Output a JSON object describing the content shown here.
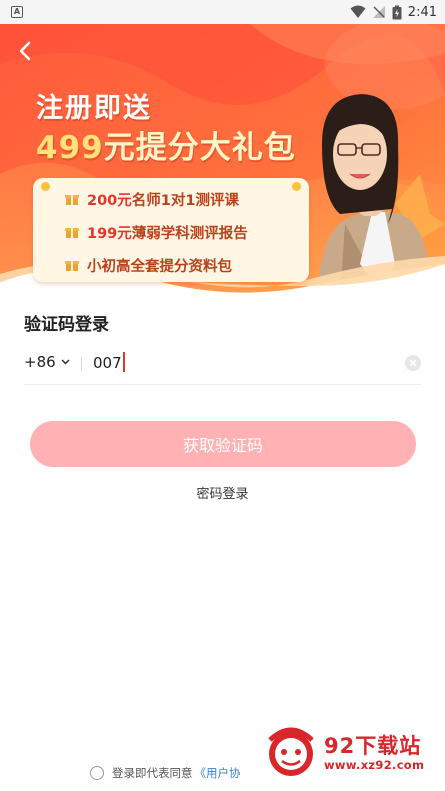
{
  "status_bar": {
    "time": "2:41"
  },
  "hero": {
    "title_line1": "注册即送",
    "title_line2_num": "499",
    "title_line2_text": "元提分大礼包",
    "benefits": [
      {
        "num": "200元",
        "text": "名师1对1测评课"
      },
      {
        "num": "199元",
        "text": "薄弱学科测评报告"
      },
      {
        "num": "",
        "text": "小初高全套提分资料包"
      }
    ]
  },
  "login": {
    "title": "验证码登录",
    "country_code": "+86",
    "phone_value": "007",
    "get_code_label": "获取验证码",
    "password_login_label": "密码登录"
  },
  "agreement": {
    "text": "登录即代表同意",
    "link": "《用户协"
  },
  "watermark": {
    "title": "92下载站",
    "url": "www.xz92.com"
  },
  "colors": {
    "brand_red": "#e2362a",
    "button_disabled": "#ffb1b4",
    "link_blue": "#3b82d6"
  }
}
